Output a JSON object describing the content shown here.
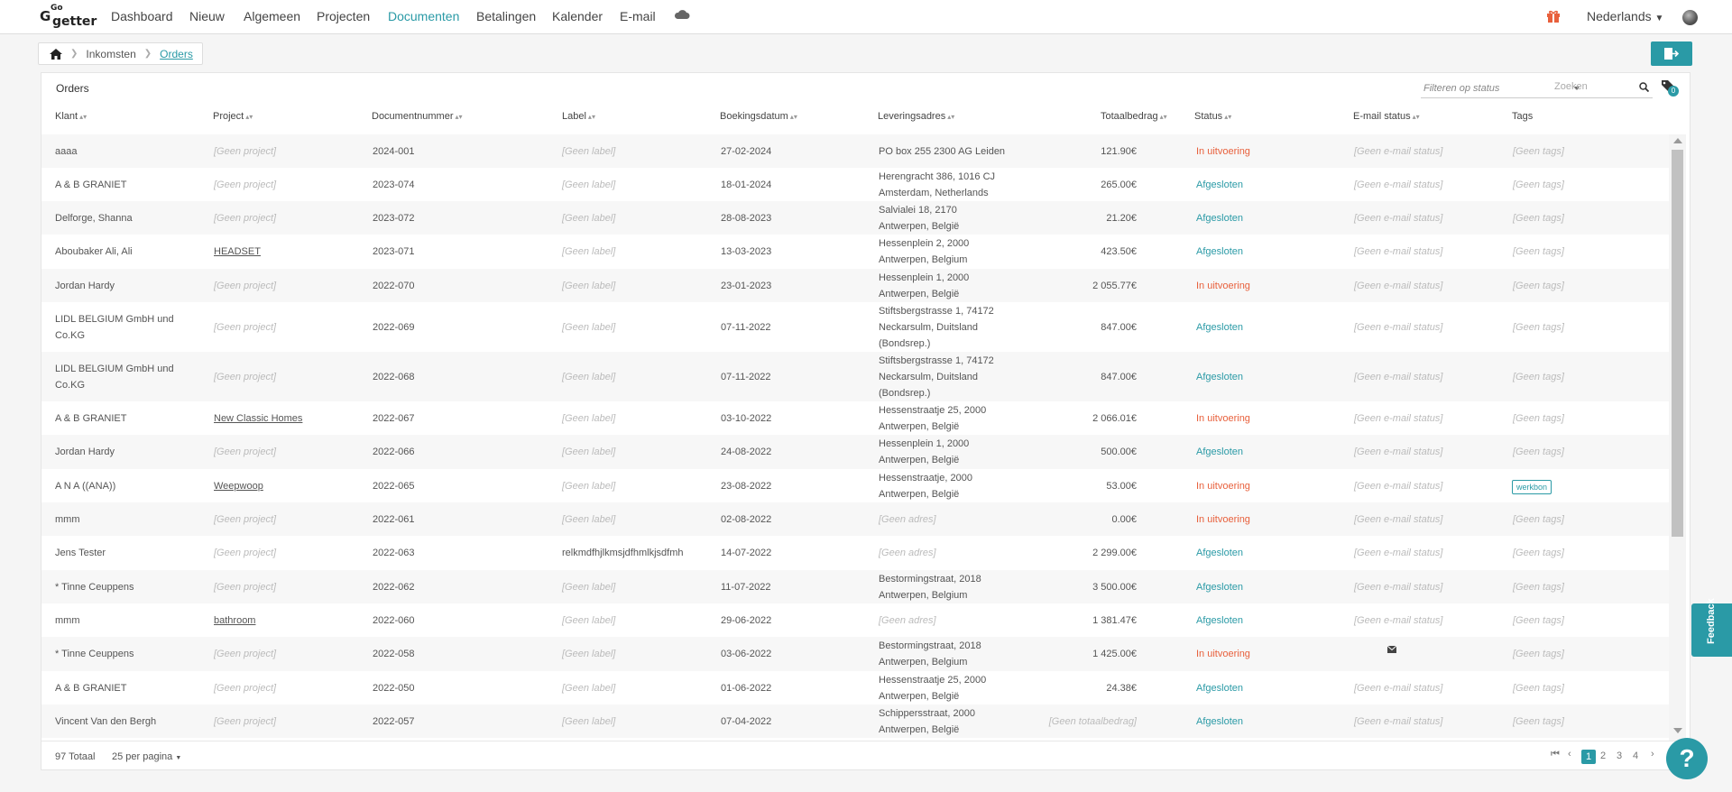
{
  "brand": {
    "go_top": "Go",
    "go_small": "Go",
    "getter": "getter",
    "accent": "#2a9aa6",
    "status_open_color": "#e8603c"
  },
  "nav": {
    "items": [
      {
        "label": "Dashboard"
      },
      {
        "label": "Nieuw"
      },
      {
        "label": "Algemeen"
      },
      {
        "label": "Projecten"
      },
      {
        "label": "Documenten"
      },
      {
        "label": "Betalingen"
      },
      {
        "label": "Kalender"
      },
      {
        "label": "E-mail"
      }
    ],
    "active": "Documenten",
    "language": "Nederlands",
    "icons": [
      "cloud-icon",
      "gift-icon",
      "avatar"
    ]
  },
  "breadcrumb": {
    "items": [
      "Inkomsten",
      "Orders"
    ],
    "home_icon": "home-icon"
  },
  "export_icon": "export-icon",
  "card": {
    "title": "Orders",
    "filter_placeholder": "Filteren op status",
    "search_placeholder": "Zoeken",
    "tag_badge_count": "0"
  },
  "columns": [
    "Klant",
    "Project",
    "Documentnummer",
    "Label",
    "Boekingsdatum",
    "Leveringsadres",
    "Totaalbedrag",
    "Status",
    "E-mail status",
    "Tags"
  ],
  "rows": [
    {
      "klant": [
        "aaaa"
      ],
      "project": "[Geen project]",
      "project_link": false,
      "nummer": "2024-001",
      "label": "[Geen label]",
      "datum": "27-02-2024",
      "adres": [
        "PO box 255 2300 AG Leiden"
      ],
      "totaal": "121.90€",
      "status": "In uitvoering",
      "email": "[Geen e-mail status]",
      "tags": "[Geen tags]"
    },
    {
      "klant": [
        "A & B GRANIET"
      ],
      "project": "[Geen project]",
      "project_link": false,
      "nummer": "2023-074",
      "label": "[Geen label]",
      "datum": "18-01-2024",
      "adres": [
        "Herengracht 386, 1016 CJ",
        "Amsterdam, Netherlands"
      ],
      "totaal": "265.00€",
      "status": "Afgesloten",
      "email": "[Geen e-mail status]",
      "tags": "[Geen tags]"
    },
    {
      "klant": [
        "Delforge, Shanna"
      ],
      "project": "[Geen project]",
      "project_link": false,
      "nummer": "2023-072",
      "label": "[Geen label]",
      "datum": "28-08-2023",
      "adres": [
        "Salvialei 18, 2170",
        "Antwerpen, België"
      ],
      "totaal": "21.20€",
      "status": "Afgesloten",
      "email": "[Geen e-mail status]",
      "tags": "[Geen tags]"
    },
    {
      "klant": [
        "Aboubaker Ali, Ali"
      ],
      "project": "HEADSET",
      "project_link": true,
      "nummer": "2023-071",
      "label": "[Geen label]",
      "datum": "13-03-2023",
      "adres": [
        "Hessenplein 2, 2000",
        "Antwerpen, Belgium"
      ],
      "totaal": "423.50€",
      "status": "Afgesloten",
      "email": "[Geen e-mail status]",
      "tags": "[Geen tags]"
    },
    {
      "klant": [
        "Jordan Hardy"
      ],
      "project": "[Geen project]",
      "project_link": false,
      "nummer": "2022-070",
      "label": "[Geen label]",
      "datum": "23-01-2023",
      "adres": [
        "Hessenplein 1, 2000",
        "Antwerpen, België"
      ],
      "totaal": "2 055.77€",
      "status": "In uitvoering",
      "email": "[Geen e-mail status]",
      "tags": "[Geen tags]"
    },
    {
      "klant": [
        "LIDL BELGIUM GmbH und",
        "Co.KG"
      ],
      "project": "[Geen project]",
      "project_link": false,
      "nummer": "2022-069",
      "label": "[Geen label]",
      "datum": "07-11-2022",
      "adres": [
        "Stiftsbergstrasse 1, 74172",
        "Neckarsulm, Duitsland",
        "(Bondsrep.)"
      ],
      "totaal": "847.00€",
      "status": "Afgesloten",
      "email": "[Geen e-mail status]",
      "tags": "[Geen tags]"
    },
    {
      "klant": [
        "LIDL BELGIUM GmbH und",
        "Co.KG"
      ],
      "project": "[Geen project]",
      "project_link": false,
      "nummer": "2022-068",
      "label": "[Geen label]",
      "datum": "07-11-2022",
      "adres": [
        "Stiftsbergstrasse 1, 74172",
        "Neckarsulm, Duitsland",
        "(Bondsrep.)"
      ],
      "totaal": "847.00€",
      "status": "Afgesloten",
      "email": "[Geen e-mail status]",
      "tags": "[Geen tags]"
    },
    {
      "klant": [
        "A & B GRANIET"
      ],
      "project": "New Classic Homes",
      "project_link": true,
      "nummer": "2022-067",
      "label": "[Geen label]",
      "datum": "03-10-2022",
      "adres": [
        "Hessenstraatje 25, 2000",
        "Antwerpen, België"
      ],
      "totaal": "2 066.01€",
      "status": "In uitvoering",
      "email": "[Geen e-mail status]",
      "tags": "[Geen tags]"
    },
    {
      "klant": [
        "Jordan Hardy"
      ],
      "project": "[Geen project]",
      "project_link": false,
      "nummer": "2022-066",
      "label": "[Geen label]",
      "datum": "24-08-2022",
      "adres": [
        "Hessenplein 1, 2000",
        "Antwerpen, België"
      ],
      "totaal": "500.00€",
      "status": "Afgesloten",
      "email": "[Geen e-mail status]",
      "tags": "[Geen tags]"
    },
    {
      "klant": [
        "A N A ((ANA))"
      ],
      "project": "Weepwoop",
      "project_link": true,
      "nummer": "2022-065",
      "label": "[Geen label]",
      "datum": "23-08-2022",
      "adres": [
        "Hessenstraatje, 2000",
        "Antwerpen, België"
      ],
      "totaal": "53.00€",
      "status": "In uitvoering",
      "email": "[Geen e-mail status]",
      "tags": "werkbon",
      "tag_chip": true
    },
    {
      "klant": [
        "mmm"
      ],
      "project": "[Geen project]",
      "project_link": false,
      "nummer": "2022-061",
      "label": "[Geen label]",
      "datum": "02-08-2022",
      "adres": [
        "[Geen adres]"
      ],
      "adres_empty": true,
      "totaal": "0.00€",
      "status": "In uitvoering",
      "email": "[Geen e-mail status]",
      "tags": "[Geen tags]"
    },
    {
      "klant": [
        "Jens Tester"
      ],
      "project": "[Geen project]",
      "project_link": false,
      "nummer": "2022-063",
      "label": "relkmdfhjlkmsjdfhmlkjsdfmh",
      "label_real": true,
      "datum": "14-07-2022",
      "adres": [
        "[Geen adres]"
      ],
      "adres_empty": true,
      "totaal": "2 299.00€",
      "status": "Afgesloten",
      "email": "[Geen e-mail status]",
      "tags": "[Geen tags]"
    },
    {
      "klant": [
        "* Tinne Ceuppens"
      ],
      "project": "[Geen project]",
      "project_link": false,
      "nummer": "2022-062",
      "label": "[Geen label]",
      "datum": "11-07-2022",
      "adres": [
        "Bestormingstraat, 2018",
        "Antwerpen, Belgium"
      ],
      "totaal": "3 500.00€",
      "status": "Afgesloten",
      "email": "[Geen e-mail status]",
      "tags": "[Geen tags]"
    },
    {
      "klant": [
        "mmm"
      ],
      "project": "bathroom",
      "project_link": true,
      "nummer": "2022-060",
      "label": "[Geen label]",
      "datum": "29-06-2022",
      "adres": [
        "[Geen adres]"
      ],
      "adres_empty": true,
      "totaal": "1 381.47€",
      "status": "Afgesloten",
      "email": "[Geen e-mail status]",
      "tags": "[Geen tags]"
    },
    {
      "klant": [
        "* Tinne Ceuppens"
      ],
      "project": "[Geen project]",
      "project_link": false,
      "nummer": "2022-058",
      "label": "[Geen label]",
      "datum": "03-06-2022",
      "adres": [
        "Bestormingstraat, 2018",
        "Antwerpen, Belgium"
      ],
      "totaal": "1 425.00€",
      "status": "In uitvoering",
      "email": "",
      "email_icon": "envelope-icon",
      "tags": "[Geen tags]"
    },
    {
      "klant": [
        "A & B GRANIET"
      ],
      "project": "[Geen project]",
      "project_link": false,
      "nummer": "2022-050",
      "label": "[Geen label]",
      "datum": "01-06-2022",
      "adres": [
        "Hessenstraatje 25, 2000",
        "Antwerpen, België"
      ],
      "totaal": "24.38€",
      "status": "Afgesloten",
      "email": "[Geen e-mail status]",
      "tags": "[Geen tags]"
    },
    {
      "klant": [
        "Vincent Van den Bergh"
      ],
      "project": "[Geen project]",
      "project_link": false,
      "nummer": "2022-057",
      "label": "[Geen label]",
      "datum": "07-04-2022",
      "adres": [
        "Schippersstraat, 2000",
        "Antwerpen, België"
      ],
      "totaal": "[Geen totaalbedrag]",
      "totaal_empty": true,
      "status": "Afgesloten",
      "email": "[Geen e-mail status]",
      "tags": "[Geen tags]"
    }
  ],
  "footer": {
    "total": "97 Totaal",
    "per_page": "25 per pagina",
    "pages": [
      "1",
      "2",
      "3",
      "4"
    ],
    "current_page": "1"
  },
  "feedback": "Feedback",
  "help": "?"
}
